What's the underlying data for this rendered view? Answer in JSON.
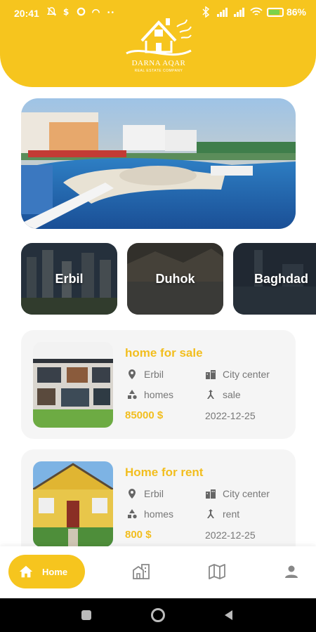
{
  "status_bar": {
    "time": "20:41",
    "battery_percent": "86%",
    "battery_level": 0.86
  },
  "logo": {
    "name": "DARNA AQAR",
    "tagline": "REAL ESTATE COMPANY"
  },
  "colors": {
    "accent": "#F6C51E",
    "text_accent": "#F2BE1F",
    "muted_text": "#777777",
    "card_bg": "#F5F5F5"
  },
  "cities": [
    {
      "label": "Erbil"
    },
    {
      "label": "Duhok"
    },
    {
      "label": "Baghdad"
    }
  ],
  "listings": [
    {
      "title": "home for sale",
      "city": "Erbil",
      "area": "City center",
      "category": "homes",
      "type": "sale",
      "price": "85000 $",
      "date": "2022-12-25"
    },
    {
      "title": "Home for rent",
      "city": "Erbil",
      "area": "City center",
      "category": "homes",
      "type": "rent",
      "price": "800 $",
      "date": "2022-12-25"
    }
  ],
  "bottom_nav": {
    "home_label": "Home",
    "icons": [
      "home-icon",
      "buildings-icon",
      "map-icon",
      "profile-icon"
    ]
  }
}
